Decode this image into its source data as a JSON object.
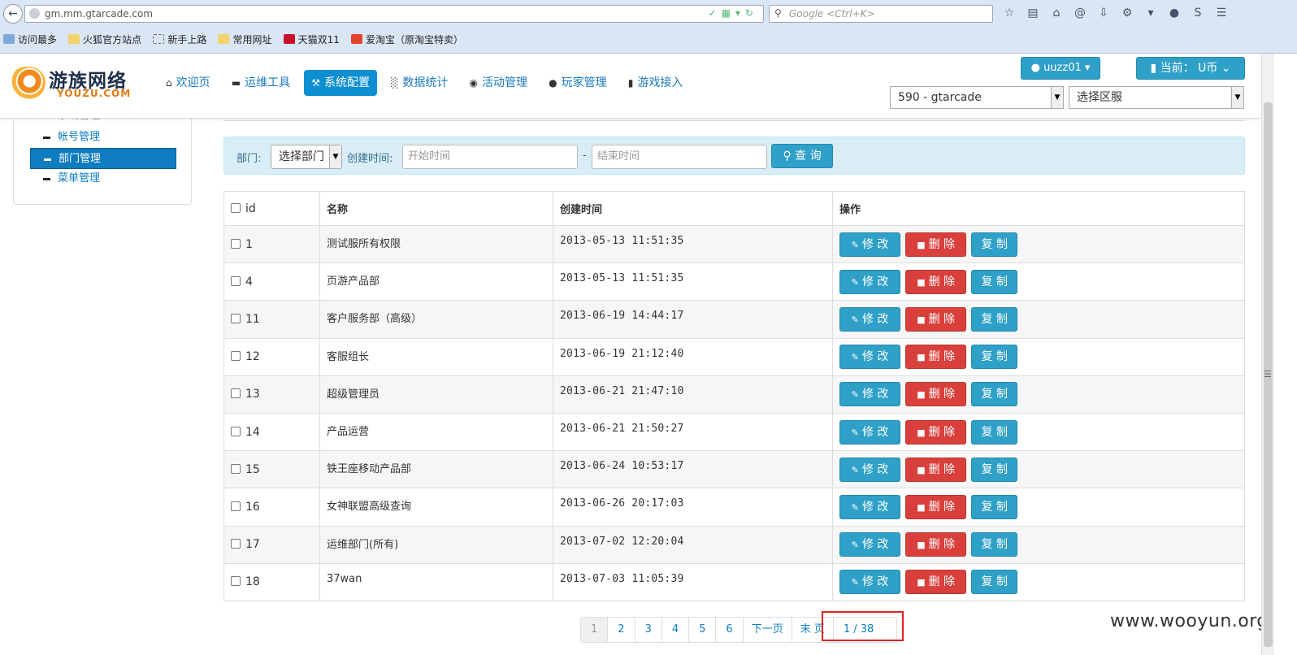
{
  "browser": {
    "url": "gm.mm.gtarcade.com",
    "search_placeholder": "Google <Ctrl+K>",
    "bookmarks": [
      "访问最多",
      "火狐官方站点",
      "新手上路",
      "常用网址",
      "天猫双11",
      "爱淘宝（原淘宝特卖）"
    ]
  },
  "logo": {
    "cn": "游族网络",
    "en": "YOUZU.COM"
  },
  "nav": {
    "items": [
      {
        "label": "欢迎页",
        "icon": "home-icon"
      },
      {
        "label": "运维工具",
        "icon": "hdd-icon"
      },
      {
        "label": "系统配置",
        "icon": "wrench-icon",
        "active": true
      },
      {
        "label": "数据统计",
        "icon": "bar-chart-icon"
      },
      {
        "label": "活动管理",
        "icon": "globe-icon"
      },
      {
        "label": "玩家管理",
        "icon": "user-icon"
      },
      {
        "label": "游戏接入",
        "icon": "book-icon"
      }
    ],
    "user_label": "uuzz01",
    "current_label": "当前：  U币",
    "server_select": "590 - gtarcade",
    "zone_select": "选择区服"
  },
  "sidebar": {
    "cut_item": "系统管理",
    "items": [
      {
        "label": "帐号管理"
      },
      {
        "label": "部门管理",
        "active": true
      },
      {
        "label": "菜单管理"
      }
    ]
  },
  "filter": {
    "dept_label": "部门:",
    "dept_value": "选择部门",
    "time_label": "创建时间:",
    "start_placeholder": "开始时间",
    "dash": "-",
    "end_placeholder": "结束时间",
    "query_label": "查 询"
  },
  "table": {
    "headers": [
      "id",
      "名称",
      "创建时间",
      "操作"
    ],
    "actions": {
      "edit": "修 改",
      "delete": "删 除",
      "copy": "复 制"
    },
    "rows": [
      {
        "id": "1",
        "name": "测试服所有权限",
        "time": "2013-05-13 11:51:35"
      },
      {
        "id": "4",
        "name": "页游产品部",
        "time": "2013-05-13 11:51:35"
      },
      {
        "id": "11",
        "name": "客户服务部（高级）",
        "time": "2013-06-19 14:44:17"
      },
      {
        "id": "12",
        "name": "客服组长",
        "time": "2013-06-19 21:12:40"
      },
      {
        "id": "13",
        "name": "超级管理员",
        "time": "2013-06-21 21:47:10"
      },
      {
        "id": "14",
        "name": "产品运营",
        "time": "2013-06-21 21:50:27"
      },
      {
        "id": "15",
        "name": "铁王座移动产品部",
        "time": "2013-06-24 10:53:17"
      },
      {
        "id": "16",
        "name": "女神联盟高级查询",
        "time": "2013-06-26 20:17:03"
      },
      {
        "id": "17",
        "name": "运维部门(所有)",
        "time": "2013-07-02 12:20:04"
      },
      {
        "id": "18",
        "name": "37wan",
        "time": "2013-07-03 11:05:39"
      }
    ]
  },
  "pager": {
    "pages": [
      "1",
      "2",
      "3",
      "4",
      "5",
      "6"
    ],
    "next": "下一页",
    "last": "末 页",
    "status": "1 / 38"
  },
  "watermark": "www.wooyun.org"
}
